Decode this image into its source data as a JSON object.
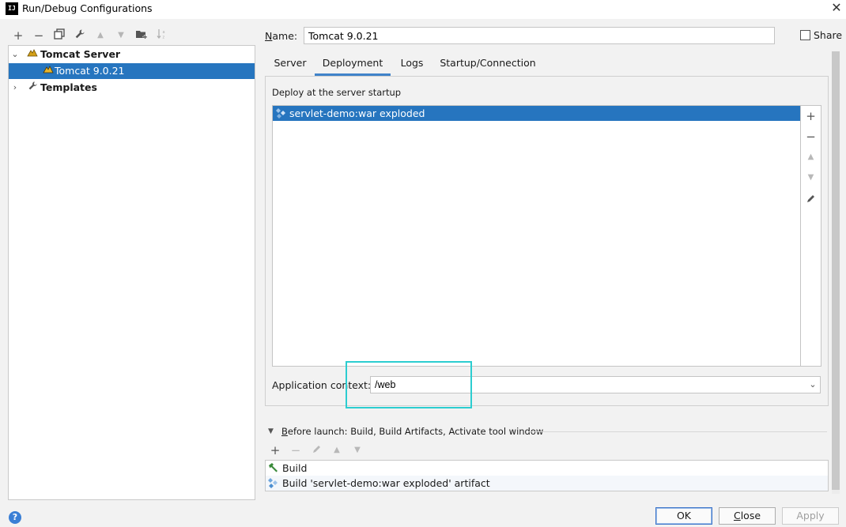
{
  "window": {
    "title": "Run/Debug Configurations",
    "logo": "IJ",
    "close_glyph": "✕"
  },
  "left_toolbar": {
    "icons": [
      "plus-icon",
      "minus-icon",
      "copy-icon",
      "wrench-icon",
      "arrow-up-icon",
      "arrow-down-icon",
      "folder-add-icon",
      "sort-alpha-icon"
    ]
  },
  "tree": {
    "items": [
      {
        "label": "Tomcat Server",
        "icon": "tomcat-icon",
        "expanded": true
      },
      {
        "label": "Tomcat 9.0.21",
        "icon": "tomcat-icon",
        "selected": true
      },
      {
        "label": "Templates",
        "icon": "wrench-icon",
        "expanded": false
      }
    ]
  },
  "name_field": {
    "label_accel": "N",
    "label_rest": "ame:",
    "value": "Tomcat 9.0.21"
  },
  "share": {
    "label": "Share",
    "checked": false
  },
  "tabs": [
    {
      "label": "Server",
      "active": false
    },
    {
      "label": "Deployment",
      "active": true
    },
    {
      "label": "Logs",
      "active": false
    },
    {
      "label": "Startup/Connection",
      "active": false
    }
  ],
  "deployment": {
    "section_label": "Deploy at the server startup",
    "artifacts": [
      "servlet-demo:war exploded"
    ],
    "side_icons": [
      "plus-icon",
      "minus-icon",
      "arrow-up-icon",
      "arrow-down-icon",
      "pencil-icon"
    ]
  },
  "app_context": {
    "label": "Application context:",
    "value": "/web"
  },
  "before_launch": {
    "label_accel": "B",
    "label_rest": "efore launch: Build, Build Artifacts, Activate tool window",
    "tasks": [
      {
        "label": "Build",
        "icon": "hammer-icon"
      },
      {
        "label": "Build 'servlet-demo:war exploded' artifact",
        "icon": "artifact-icon"
      }
    ]
  },
  "buttons": {
    "ok": "OK",
    "close_accel": "C",
    "close_rest": "lose",
    "apply": "Apply"
  },
  "colors": {
    "selection": "#2675bf",
    "highlight_box": "#2ccdd0",
    "tab_underline": "#4083c9"
  }
}
